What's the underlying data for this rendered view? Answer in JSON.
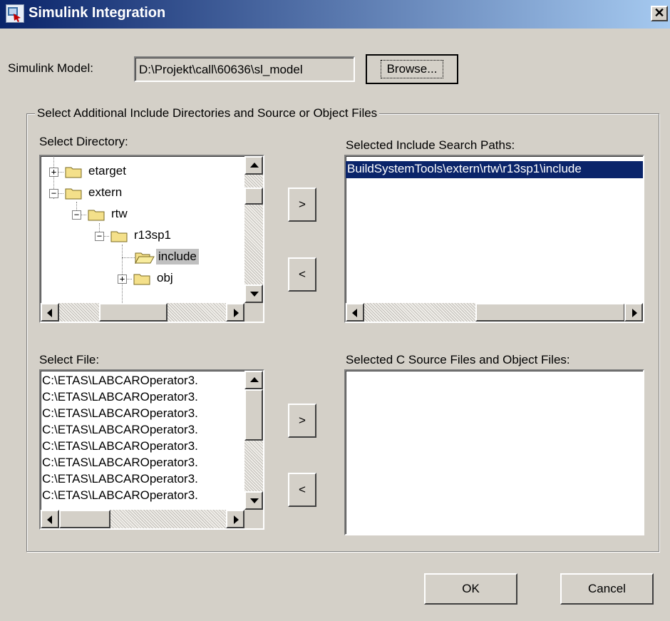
{
  "window": {
    "title": "Simulink Integration",
    "close_glyph": "✕"
  },
  "model": {
    "label": "Simulink Model:",
    "value": "D:\\Projekt\\call\\60636\\sl_model",
    "browse_label": "Browse..."
  },
  "group": {
    "title": "Select Additional Include Directories and Source or Object Files"
  },
  "directory": {
    "label": "Select Directory:",
    "tree": [
      {
        "label": "etarget",
        "expander": "+"
      },
      {
        "label": "extern",
        "expander": "−"
      },
      {
        "label": "rtw",
        "expander": "−"
      },
      {
        "label": "r13sp1",
        "expander": "−"
      },
      {
        "label": "include",
        "expander": "",
        "selected": true
      },
      {
        "label": "obj",
        "expander": "+"
      }
    ]
  },
  "include_paths": {
    "label": "Selected Include Search Paths:",
    "items": [
      "BuildSystemTools\\extern\\rtw\\r13sp1\\include"
    ]
  },
  "files": {
    "label": "Select File:",
    "items": [
      "C:\\ETAS\\LABCAROperator3.",
      "C:\\ETAS\\LABCAROperator3.",
      "C:\\ETAS\\LABCAROperator3.",
      "C:\\ETAS\\LABCAROperator3.",
      "C:\\ETAS\\LABCAROperator3.",
      "C:\\ETAS\\LABCAROperator3.",
      "C:\\ETAS\\LABCAROperator3.",
      "C:\\ETAS\\LABCAROperator3."
    ]
  },
  "source_files": {
    "label": "Selected C Source Files and Object Files:",
    "items": []
  },
  "move_buttons": {
    "add": ">",
    "remove": "<"
  },
  "footer": {
    "ok_label": "OK",
    "cancel_label": "Cancel"
  },
  "colors": {
    "titlebar_start": "#0a246a",
    "titlebar_end": "#a6caf0",
    "selection": "#0a246a",
    "face": "#d4d0c8",
    "folder": "#f4e08a"
  }
}
